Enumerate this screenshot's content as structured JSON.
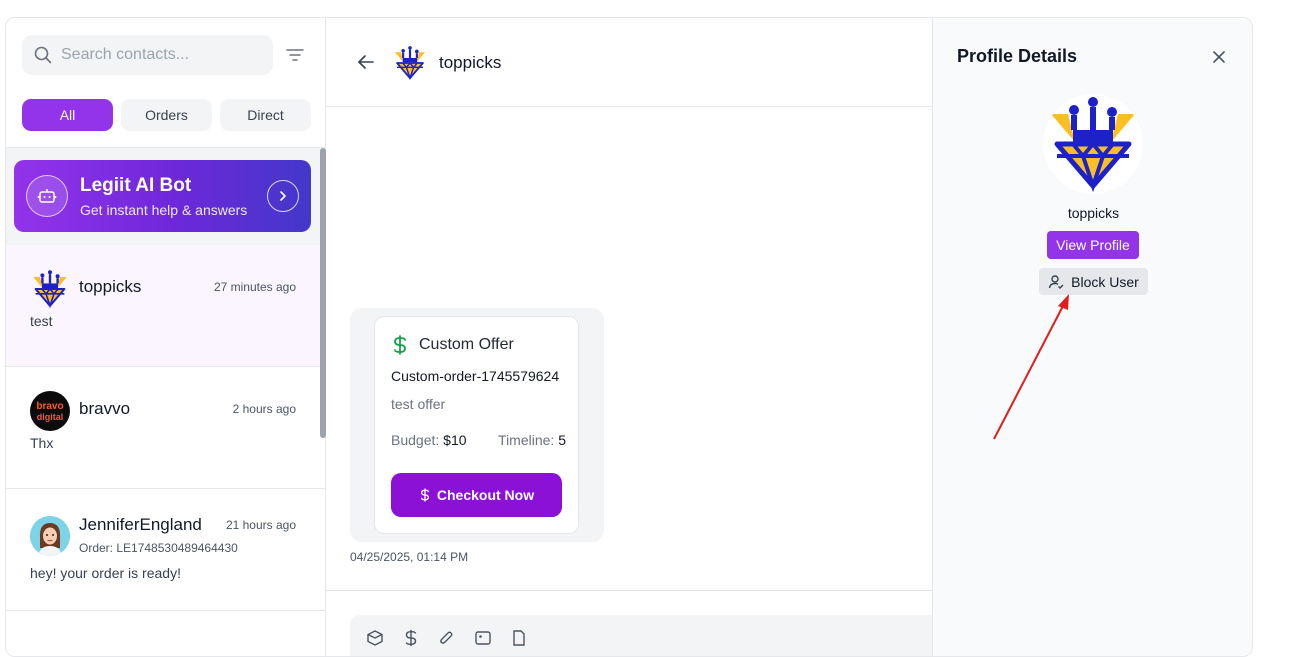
{
  "search": {
    "placeholder": "Search contacts..."
  },
  "tabs": [
    {
      "label": "All",
      "active": true
    },
    {
      "label": "Orders",
      "active": false
    },
    {
      "label": "Direct",
      "active": false
    }
  ],
  "bot": {
    "title": "Legiit AI Bot",
    "subtitle": "Get instant help & answers"
  },
  "conversations": [
    {
      "name": "toppicks",
      "time": "27 minutes ago",
      "order": "",
      "message": "test",
      "active": true
    },
    {
      "name": "bravvo",
      "time": "2 hours ago",
      "order": "",
      "message": "Thx",
      "active": false,
      "avatar_text": "bravo digital"
    },
    {
      "name": "JenniferEngland",
      "time": "21 hours ago",
      "order": "Order: LE1748530489464430",
      "message": "hey! your order is ready!",
      "active": false
    }
  ],
  "chat": {
    "contact_name": "toppicks",
    "offer": {
      "title": "Custom Offer",
      "order_id": "Custom-order-1745579624",
      "description": "test offer",
      "budget_label": "Budget:",
      "budget_value": "$10",
      "timeline_label": "Timeline:",
      "timeline_value": "5",
      "button_label": "Checkout Now"
    },
    "timestamp": "04/25/2025, 01:14 PM"
  },
  "profile": {
    "title": "Profile Details",
    "name": "toppicks",
    "view_profile_label": "View Profile",
    "block_user_label": "Block User"
  },
  "colors": {
    "accent": "#9333ea",
    "checkout": "#8b11d6",
    "bot_gradient_end": "#4338ca",
    "dollar_green": "#16a34a",
    "annotation_arrow": "#e11d1d"
  },
  "icons": [
    "search-icon",
    "filter-icon",
    "robot-icon",
    "chevron-right-icon",
    "back-arrow-icon",
    "dollar-icon",
    "close-icon",
    "user-block-icon"
  ]
}
